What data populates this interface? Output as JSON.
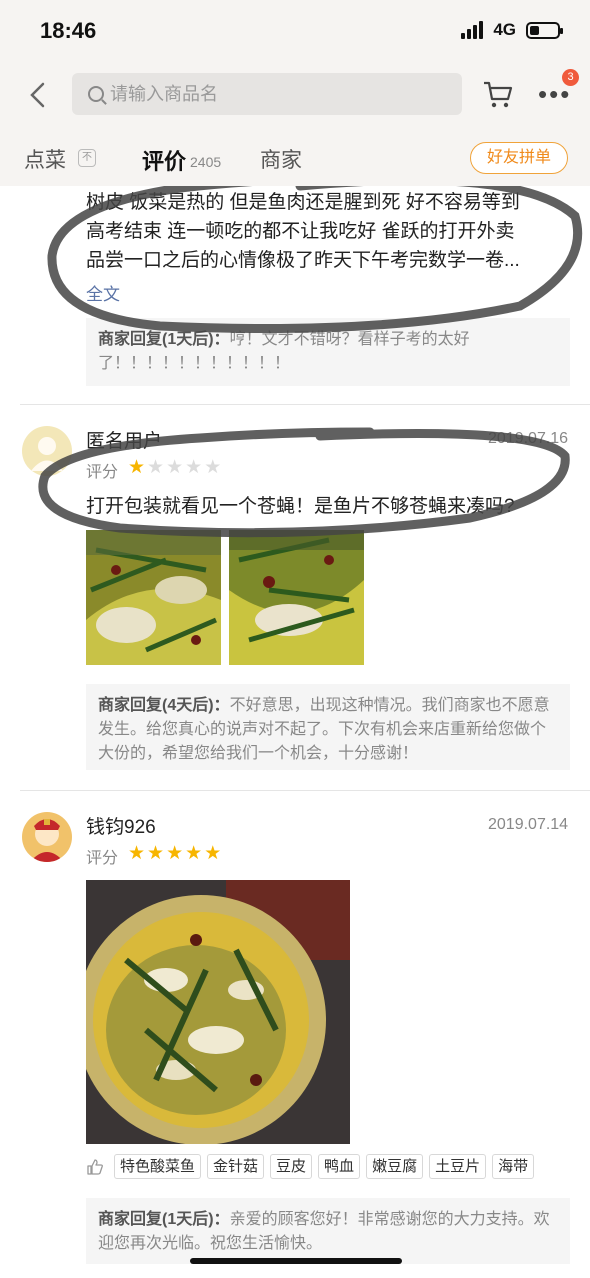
{
  "status_bar": {
    "time": "18:46",
    "network": "4G"
  },
  "header": {
    "search_placeholder": "请输入商品名",
    "cart_badge": "3"
  },
  "tabs": {
    "order": "点菜",
    "order_mark": "不",
    "reviews": "评价",
    "reviews_count": "2405",
    "merchant": "商家",
    "group_order": "好友拼单"
  },
  "reviews": [
    {
      "text_lines": [
        "树皮  饭菜是热的 但是鱼肉还是腥到死 好不容易等到",
        "高考结束 连一顿吃的都不让我吃好 雀跃的打开外卖",
        "品尝一口之后的心情像极了昨天下午考完数学一卷..."
      ],
      "fulltext_label": "全文",
      "reply_label": "商家回复(1天后)：",
      "reply_text": "哼！文才不错呀？看样子考的太好了！！！！！！！！！！！"
    },
    {
      "username": "匿名用户",
      "date": "2019.07.16",
      "rating_label": "评分",
      "rating": 1,
      "text": "打开包装就看见一个苍蝇！是鱼片不够苍蝇来凑吗?",
      "reply_label": "商家回复(4天后)：",
      "reply_text": "不好意思，出现这种情况。我们商家也不愿意发生。给您真心的说声对不起了。下次有机会来店重新给您做个大份的，希望您给我们一个机会，十分感谢！"
    },
    {
      "username": "钱钧926",
      "date": "2019.07.14",
      "rating_label": "评分",
      "rating": 5,
      "tags": [
        "特色酸菜鱼",
        "金针菇",
        "豆皮",
        "鸭血",
        "嫩豆腐",
        "土豆片",
        "海带"
      ],
      "reply_label": "商家回复(1天后)：",
      "reply_text": "亲爱的顾客您好！非常感谢您的大力支持。欢迎您再次光临。祝您生活愉快。"
    }
  ],
  "colors": {
    "accent": "#f08a1a",
    "star": "#f7b500",
    "badge": "#f05a3c",
    "link": "#5a73a6"
  },
  "icons": [
    "back-icon",
    "search-icon",
    "cart-icon",
    "more-icon",
    "thumb-icon"
  ]
}
